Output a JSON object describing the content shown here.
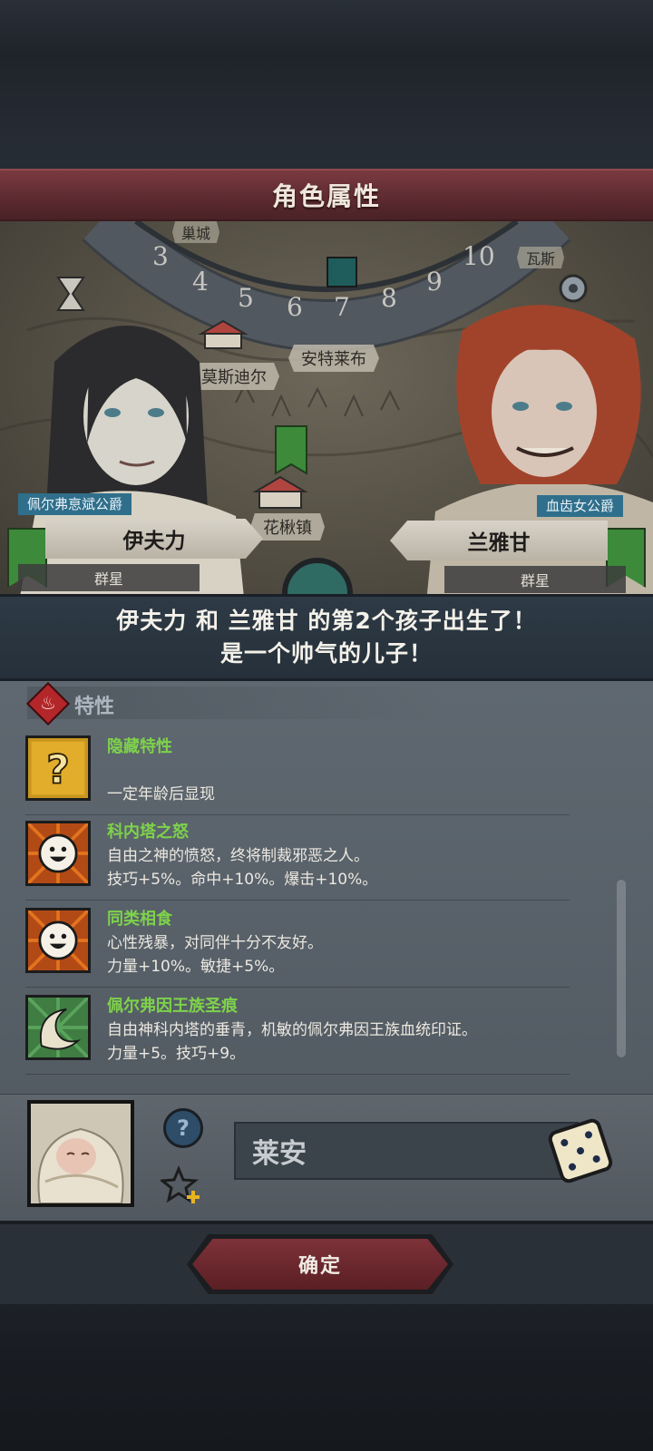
{
  "header": {
    "title": "角色属性"
  },
  "map": {
    "labels": {
      "top_left": "巢城",
      "top_right": "瓦斯",
      "center": "安特莱布",
      "left": "莫斯迪尔",
      "bottom": "花楸镇"
    },
    "wheel_numbers": [
      "3",
      "4",
      "5",
      "6",
      "7",
      "8",
      "9",
      "10"
    ]
  },
  "father": {
    "title": "佩尔弗恴斌公爵",
    "name": "伊夫力",
    "subtitle": "群星"
  },
  "mother": {
    "title": "血齿女公爵",
    "name": "兰雅甘",
    "subtitle": "群星"
  },
  "announcement": {
    "line1": "伊夫力 和 兰雅甘 的第2个孩子出生了！",
    "line2": "是一个帅气的儿子！"
  },
  "traits": {
    "header": "特性",
    "items": [
      {
        "name": "隐藏特性",
        "line1": "",
        "line2": "一定年龄后显现",
        "icon": "question-mark-icon"
      },
      {
        "name": "科内塔之怒",
        "line1": "自由之神的愤怒，终将制裁邪恶之人。",
        "line2": "技巧+5%。命中+10%。爆击+10%。",
        "icon": "smiling-face-icon"
      },
      {
        "name": "同类相食",
        "line1": "心性残暴，对同伴十分不友好。",
        "line2": "力量+10%。敏捷+5%。",
        "icon": "smiling-face-icon"
      },
      {
        "name": "佩尔弗因王族圣痕",
        "line1": "自由神科内塔的垂青，机敏的佩尔弗因王族血统印证。",
        "line2": "力量+5。技巧+9。",
        "icon": "feather-swirl-icon"
      }
    ]
  },
  "child": {
    "name_value": "莱安"
  },
  "footer": {
    "confirm_label": "确定"
  },
  "colors": {
    "trait_name": "#7ed24b",
    "title_band": "#5b2a30",
    "title_tag": "#2f6f8c",
    "banner": "#3c8a3a"
  }
}
